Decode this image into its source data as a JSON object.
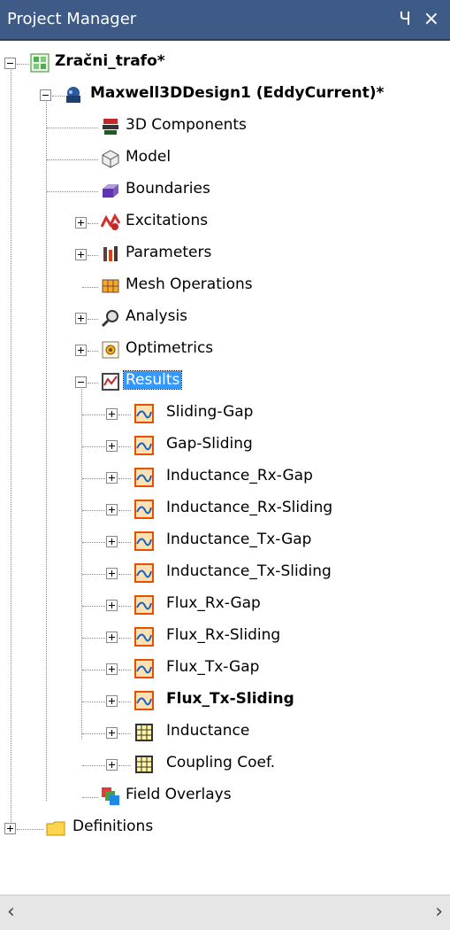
{
  "panel": {
    "title": "Project Manager",
    "pin_glyph": "Ч",
    "close_glyph": "×"
  },
  "tree": {
    "project": "Zračni_trafo*",
    "design": "Maxwell3DDesign1 (EddyCurrent)*",
    "items": [
      {
        "label": "3D Components",
        "icon": "3d-components-icon"
      },
      {
        "label": "Model",
        "icon": "model-icon"
      },
      {
        "label": "Boundaries",
        "icon": "boundaries-icon"
      },
      {
        "label": "Excitations",
        "icon": "excitations-icon"
      },
      {
        "label": "Parameters",
        "icon": "parameters-icon"
      },
      {
        "label": "Mesh Operations",
        "icon": "mesh-operations-icon"
      },
      {
        "label": "Analysis",
        "icon": "analysis-icon"
      },
      {
        "label": "Optimetrics",
        "icon": "optimetrics-icon"
      },
      {
        "label": "Results",
        "icon": "results-icon"
      }
    ],
    "results": [
      {
        "label": "Sliding-Gap"
      },
      {
        "label": "Gap-Sliding"
      },
      {
        "label": "Inductance_Rx-Gap"
      },
      {
        "label": "Inductance_Rx-Sliding"
      },
      {
        "label": "Inductance_Tx-Gap"
      },
      {
        "label": "Inductance_Tx-Sliding"
      },
      {
        "label": "Flux_Rx-Gap"
      },
      {
        "label": "Flux_Rx-Sliding"
      },
      {
        "label": "Flux_Tx-Gap"
      },
      {
        "label": "Flux_Tx-Sliding"
      },
      {
        "label": "Inductance"
      },
      {
        "label": "Coupling Coef."
      }
    ],
    "field_overlays": "Field Overlays",
    "definitions": "Definitions"
  },
  "scrollbar": {
    "left_arrow": "‹",
    "right_arrow": "›"
  }
}
